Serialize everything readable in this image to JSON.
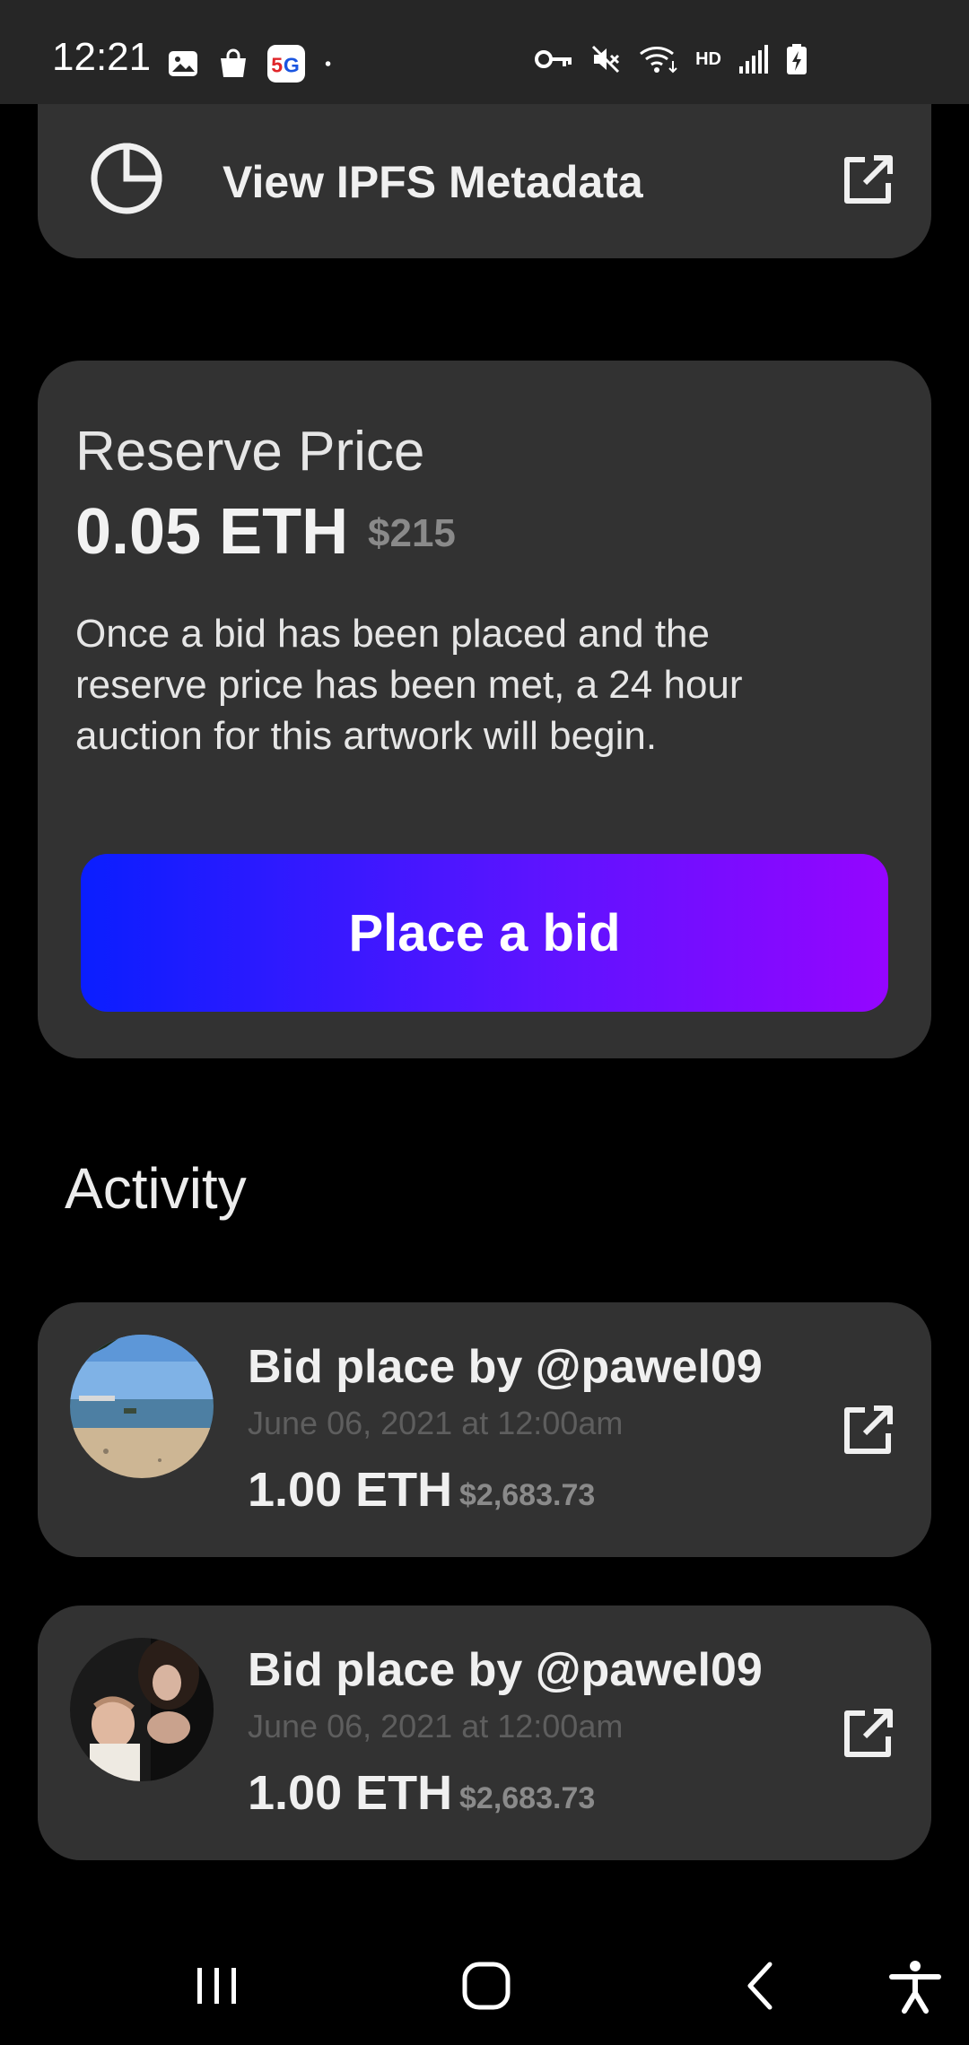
{
  "status_bar": {
    "time": "12:21",
    "left_icons": [
      "gallery-icon",
      "shopping-bag-icon",
      "5g-app-icon",
      "dot-icon"
    ],
    "right_icons": [
      "vpn-key-icon",
      "mute-icon",
      "wifi-icon",
      "hd-icon",
      "signal-icon",
      "battery-charging-icon"
    ],
    "hd_label": "HD"
  },
  "ipfs": {
    "label": "View IPFS Metadata",
    "icon": "pie-chart-icon",
    "action_icon": "external-link-icon"
  },
  "reserve": {
    "title": "Reserve Price",
    "price": "0.05 ETH",
    "usd": "$215",
    "description": "Once a bid has been placed and the reserve price has been met, a 24 hour auction for this artwork will begin.",
    "button_label": "Place a bid",
    "button_gradient": [
      "#0a1eff",
      "#9505ff"
    ]
  },
  "activity": {
    "title": "Activity",
    "items": [
      {
        "title": "Bid place by @pawel09",
        "date": "June 06, 2021 at 12:00am",
        "amount": "1.00 ETH",
        "usd": "$2,683.73",
        "avatar": "beach-photo"
      },
      {
        "title": "Bid place by @pawel09",
        "date": "June 06, 2021 at 12:00am",
        "amount": "1.00 ETH",
        "usd": "$2,683.73",
        "avatar": "couple-photo"
      }
    ]
  },
  "nav_bar": {
    "icons": [
      "recent-apps-icon",
      "home-icon",
      "back-icon",
      "accessibility-icon"
    ]
  },
  "colors": {
    "background": "#000000",
    "card": "#323232",
    "status_bar": "#262626",
    "muted_text": "#8a8a8a"
  }
}
